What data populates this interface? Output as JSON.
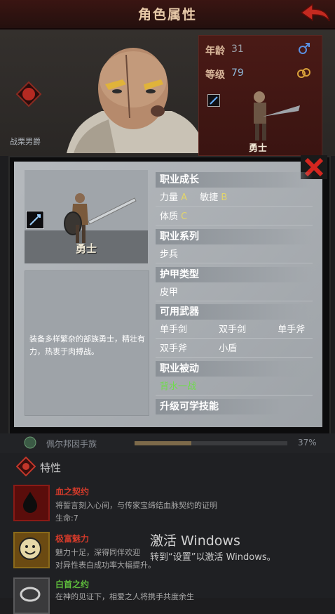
{
  "header": {
    "title": "角色属性"
  },
  "side_panel": {
    "age_label": "年龄",
    "age_value": "31",
    "level_label": "等级",
    "level_value": "79",
    "unit_label": "勇士"
  },
  "portrait": {
    "caption": "战栗男爵"
  },
  "dialog": {
    "char_name": "勇士",
    "description": "装备多样繁杂的部族勇士，精壮有力，热衷于肉搏战。",
    "growth": {
      "title": "职业成长",
      "str_label": "力量",
      "str_grade": "A",
      "agi_label": "敏捷",
      "agi_grade": "B",
      "con_label": "体质",
      "con_grade": "C"
    },
    "class_family": {
      "title": "职业系列",
      "value": "步兵"
    },
    "armor_type": {
      "title": "护甲类型",
      "value": "皮甲"
    },
    "weapons": {
      "title": "可用武器",
      "items": [
        "单手剑",
        "双手剑",
        "单手斧",
        "双手斧",
        "小盾"
      ]
    },
    "passive": {
      "title": "职业被动",
      "value": "背水一战"
    },
    "upgrade": {
      "title": "升级可学技能"
    }
  },
  "progress": {
    "label": "佩尔邦因手族",
    "percent_text": "37%",
    "percent": 0.37
  },
  "traits": {
    "title": "特性",
    "items": [
      {
        "name": "血之契约",
        "desc1": "将誓言刻入心间，与传家宝缔结血脉契约的证明",
        "desc2": "生命:7",
        "color": "#d23a2a"
      },
      {
        "name": "极富魅力",
        "desc1": "魅力十足，深得同伴欢迎",
        "desc2": "对异性表白成功率大幅提升。",
        "color": "#d23a2a"
      },
      {
        "name": "白首之约",
        "desc1": "在神的见证下，相爱之人将携手共度余生",
        "desc2": "",
        "color": "#5fbf3c"
      }
    ]
  },
  "watermark": {
    "title": "激活 Windows",
    "subtitle": "转到“设置”以激活 Windows。"
  },
  "colors": {
    "header_bg": "#2e1210",
    "panel_red": "#4a1a16",
    "dialog_gray": "#a9aeb3",
    "grade_yellow": "#e2d56b",
    "passive_green": "#6fdc4c"
  }
}
